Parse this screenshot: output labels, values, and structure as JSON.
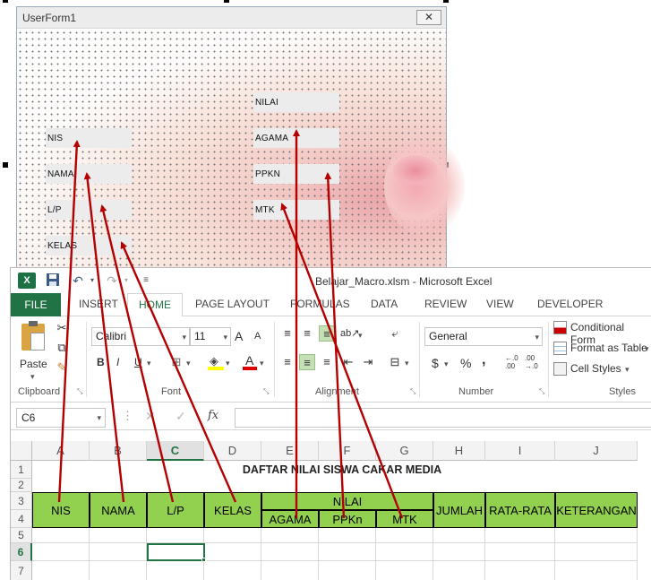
{
  "userform": {
    "title": "UserForm1",
    "close": "✕",
    "labels": {
      "nis": "NIS",
      "nama": "NAMA",
      "lp": "L/P",
      "kelas": "KELAS",
      "nilai": "NILAI",
      "agama": "AGAMA",
      "ppkn": "PPKN",
      "mtk": "MTK"
    }
  },
  "excel": {
    "logo": "X",
    "window_title": "Belajar_Macro.xlsm - Microsoft Excel",
    "tabs": {
      "file": "FILE",
      "insert": "INSERT",
      "home": "HOME",
      "page_layout": "PAGE LAYOUT",
      "formulas": "FORMULAS",
      "data": "DATA",
      "review": "REVIEW",
      "view": "VIEW",
      "developer": "DEVELOPER"
    },
    "ribbon": {
      "paste": "Paste",
      "font_name": "Calibri",
      "font_size": "11",
      "number_format": "General",
      "conditional_formatting": "Conditional Form",
      "format_as_table": "Format as Table",
      "cell_styles": "Cell Styles",
      "groups": {
        "clipboard": "Clipboard",
        "font": "Font",
        "alignment": "Alignment",
        "number": "Number",
        "styles": "Styles"
      },
      "bold": "B",
      "italic": "I",
      "underline": "U",
      "currency": "$",
      "percent": "%",
      "comma": ",",
      "grow_font": "A",
      "shrink_font": "A",
      "font_color": "A",
      "inc_decimal": "←.0\n.00",
      "dec_decimal": ".00\n→.0"
    },
    "name_box": "C6",
    "fx": "fx",
    "columns": [
      "A",
      "B",
      "C",
      "D",
      "E",
      "F",
      "G",
      "H",
      "I",
      "J"
    ],
    "rows": [
      "1",
      "2",
      "3",
      "4",
      "5",
      "6",
      "7"
    ],
    "sheet_title": "DAFTAR NILAI SISWA CAKAR MEDIA",
    "headers": {
      "nis": "NIS",
      "nama": "NAMA",
      "lp": "L/P",
      "kelas": "KELAS",
      "nilai": "NILAI",
      "agama": "AGAMA",
      "ppkn": "PPKn",
      "mtk": "MTK",
      "jumlah": "JUMLAH",
      "rata_rata": "RATA-RATA",
      "keterangan": "KETERANGAN"
    }
  },
  "colors": {
    "excel_green": "#217346",
    "header_fill": "#92d050",
    "arrow": "#b40000"
  }
}
